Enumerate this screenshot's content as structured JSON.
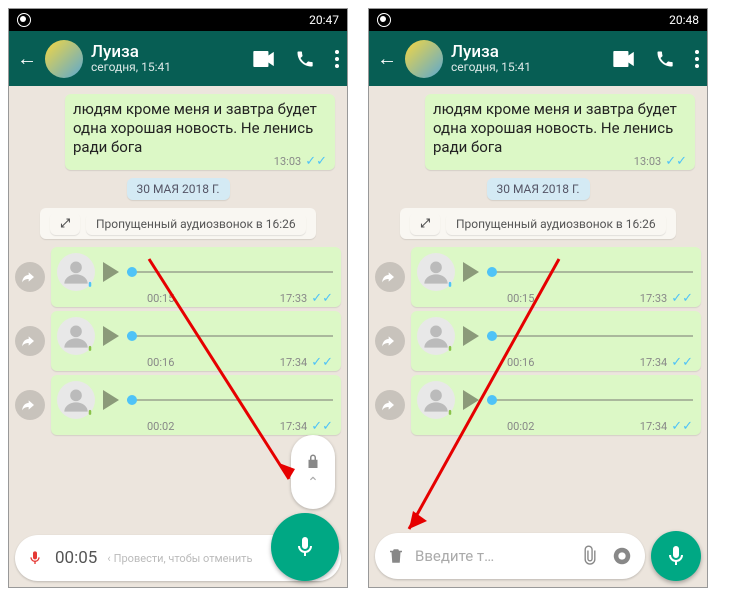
{
  "left": {
    "statusbar": {
      "time": "20:47"
    },
    "header": {
      "name": "Луиза",
      "subtitle": "сегодня, 15:41"
    },
    "message": {
      "text": "людям кроме меня и завтра будет одна хорошая новость. Не ленись ради бога",
      "time": "13:03"
    },
    "date_separator": "30 МАЯ 2018 Г.",
    "missed_call": "Пропущенный аудиозвонок в 16:26",
    "voices": [
      {
        "duration": "00:15",
        "time": "17:33",
        "heard": true
      },
      {
        "duration": "00:16",
        "time": "17:34",
        "heard": false
      },
      {
        "duration": "00:02",
        "time": "17:34",
        "heard": false
      }
    ],
    "recording": {
      "elapsed": "00:05",
      "cancel_hint": "Провести, чтобы отменить"
    }
  },
  "right": {
    "statusbar": {
      "time": "20:48"
    },
    "header": {
      "name": "Луиза",
      "subtitle": "сегодня, 15:41"
    },
    "message": {
      "text": "людям кроме меня и завтра будет одна хорошая новость. Не ленись ради бога",
      "time": "13:03"
    },
    "date_separator": "30 МАЯ 2018 Г.",
    "missed_call": "Пропущенный аудиозвонок в 16:26",
    "voices": [
      {
        "duration": "00:15",
        "time": "17:33",
        "heard": true
      },
      {
        "duration": "00:16",
        "time": "17:34",
        "heard": false
      },
      {
        "duration": "00:02",
        "time": "17:34",
        "heard": false
      }
    ],
    "input": {
      "placeholder": "Введите т…"
    }
  }
}
